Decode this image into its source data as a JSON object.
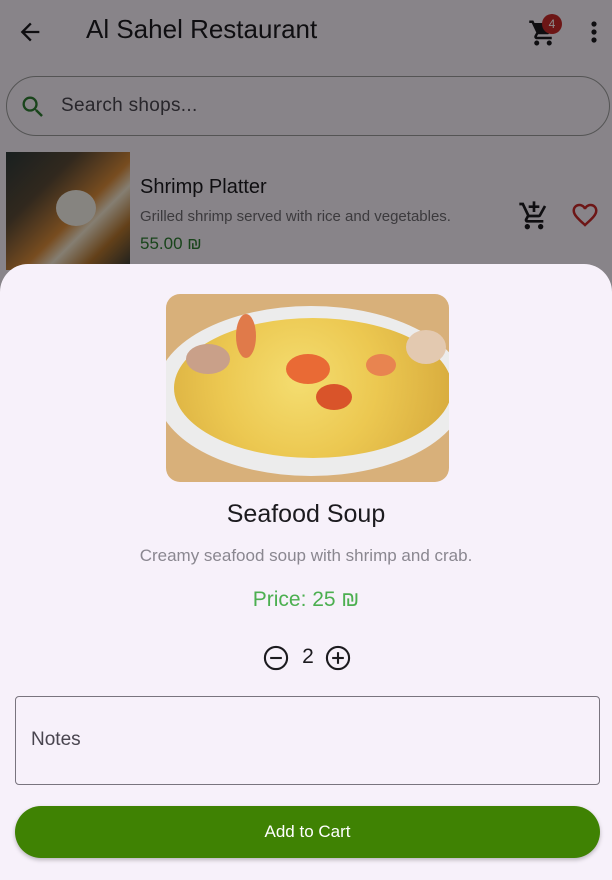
{
  "appbar": {
    "title": "Al Sahel Restaurant",
    "cart_count": "4"
  },
  "search": {
    "placeholder": "Search shops..."
  },
  "list": {
    "items": [
      {
        "title": "Shrimp Platter",
        "description": "Grilled shrimp served with rice and vegetables.",
        "price": "55.00 ₪"
      }
    ]
  },
  "sheet": {
    "title": "Seafood Soup",
    "description": "Creamy seafood soup with shrimp and crab.",
    "price": "Price: 25 ₪",
    "quantity": "2",
    "notes_placeholder": "Notes",
    "add_button_label": "Add to Cart"
  },
  "colors": {
    "accent_green": "#3f8203",
    "price_green": "#4caf50",
    "badge_red": "#c62828",
    "favorite_red": "#c62828"
  },
  "icons": [
    "back-arrow-icon",
    "cart-icon",
    "more-vert-icon",
    "search-icon",
    "add-shopping-cart-icon",
    "heart-outline-icon",
    "minus-circle-icon",
    "plus-circle-icon"
  ]
}
